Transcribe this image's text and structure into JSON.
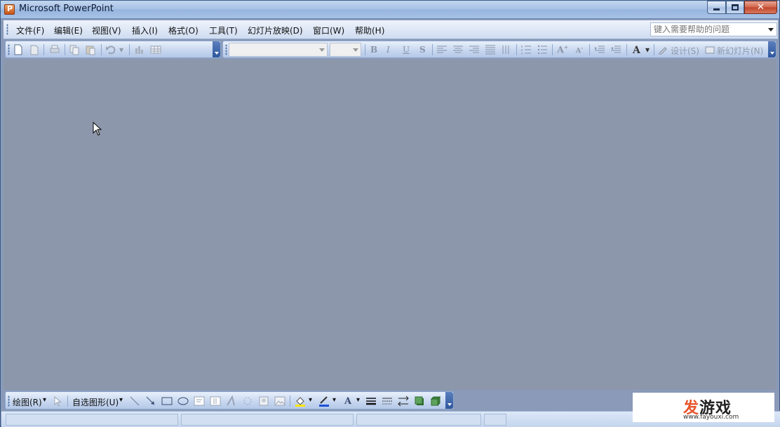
{
  "window": {
    "title": "Microsoft PowerPoint"
  },
  "menu": [
    {
      "label": "文件(F)"
    },
    {
      "label": "编辑(E)"
    },
    {
      "label": "视图(V)"
    },
    {
      "label": "插入(I)"
    },
    {
      "label": "格式(O)"
    },
    {
      "label": "工具(T)"
    },
    {
      "label": "幻灯片放映(D)"
    },
    {
      "label": "窗口(W)"
    },
    {
      "label": "帮助(H)"
    }
  ],
  "help": {
    "placeholder": "键入需要帮助的问题"
  },
  "formatting": {
    "bold": "B",
    "italic": "I",
    "underline": "U",
    "shadow": "S",
    "font_color": "A",
    "design_label": "设计(S)",
    "new_slide_label": "新幻灯片(N)"
  },
  "drawing": {
    "draw_label": "绘图(R)",
    "autoshapes_label": "自选图形(U)"
  },
  "watermark": {
    "brand_a": "发",
    "brand_b": "游戏",
    "url": "www.fayouxi.com"
  },
  "colors": {
    "title_bar": "#a9c3e6",
    "workspace": "#8d97ab",
    "accent": "#2e579e",
    "watermark": "#e8552c"
  }
}
